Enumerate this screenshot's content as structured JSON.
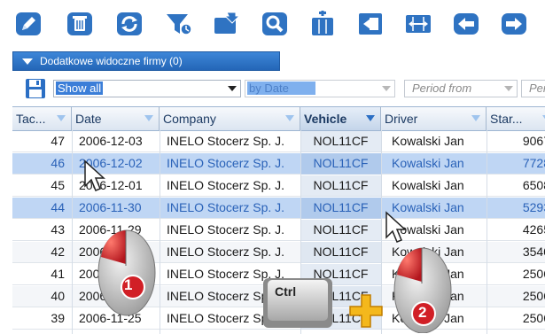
{
  "toolbar": {
    "buttons": [
      {
        "name": "edit-icon"
      },
      {
        "name": "delete-icon"
      },
      {
        "name": "refresh-icon"
      },
      {
        "name": "filter-icon"
      },
      {
        "name": "import-icon"
      },
      {
        "name": "search-icon"
      },
      {
        "name": "add-column-icon"
      },
      {
        "name": "export-icon"
      },
      {
        "name": "fit-columns-icon"
      },
      {
        "name": "back-icon"
      },
      {
        "name": "forward-icon"
      }
    ]
  },
  "firms_bar": {
    "label": "Dodatkowe widoczne firmy (0)"
  },
  "filter": {
    "view_value": "Show all",
    "sort_value": "by Date",
    "period_from": "Period from",
    "period_to": "Per"
  },
  "grid": {
    "columns": [
      "Tac...",
      "Date",
      "Company",
      "Vehicle",
      "Driver",
      "Star..."
    ],
    "rows": [
      {
        "tac": "47",
        "date": "2006-12-03",
        "company": "INELO Stocerz Sp. J.",
        "vehicle": "NOL11CF",
        "driver": "Kowalski Jan",
        "start": "9067",
        "selected": false
      },
      {
        "tac": "46",
        "date": "2006-12-02",
        "company": "INELO Stocerz Sp. J.",
        "vehicle": "NOL11CF",
        "driver": "Kowalski Jan",
        "start": "7728",
        "selected": true
      },
      {
        "tac": "45",
        "date": "2006-12-01",
        "company": "INELO Stocerz Sp. J.",
        "vehicle": "NOL11CF",
        "driver": "Kowalski Jan",
        "start": "6508",
        "selected": false
      },
      {
        "tac": "44",
        "date": "2006-11-30",
        "company": "INELO Stocerz Sp. J.",
        "vehicle": "NOL11CF",
        "driver": "Kowalski Jan",
        "start": "5293",
        "selected": true
      },
      {
        "tac": "43",
        "date": "2006-11-29",
        "company": "INELO Stocerz Sp. J.",
        "vehicle": "NOL11CF",
        "driver": "Kowalski Jan",
        "start": "4265",
        "selected": false
      },
      {
        "tac": "42",
        "date": "2006-11-28",
        "company": "INELO Stocerz Sp. J.",
        "vehicle": "NOL11CF",
        "driver": "Kowalski Jan",
        "start": "3540",
        "selected": false
      },
      {
        "tac": "41",
        "date": "2006-11-27",
        "company": "INELO Stocerz Sp. J.",
        "vehicle": "NOL11CF",
        "driver": "Kowalski Jan",
        "start": "2506",
        "selected": false
      },
      {
        "tac": "40",
        "date": "2006-11-26",
        "company": "INELO Stocerz Sp. J.",
        "vehicle": "NOL11CF",
        "driver": "Kowalski Jan",
        "start": "2506",
        "selected": false
      },
      {
        "tac": "39",
        "date": "2006-11-25",
        "company": "INELO Stocerz Sp. J.",
        "vehicle": "NOL11CF",
        "driver": "Kowalski Jan",
        "start": "2506",
        "selected": false
      }
    ]
  },
  "overlay": {
    "mouse1_number": "1",
    "mouse2_number": "2",
    "ctrl_label": "Ctrl",
    "plus": "+"
  },
  "colors": {
    "accent": "#2b6fc4",
    "selection": "#bfd6f4",
    "mouse_red": "#c0272d"
  }
}
